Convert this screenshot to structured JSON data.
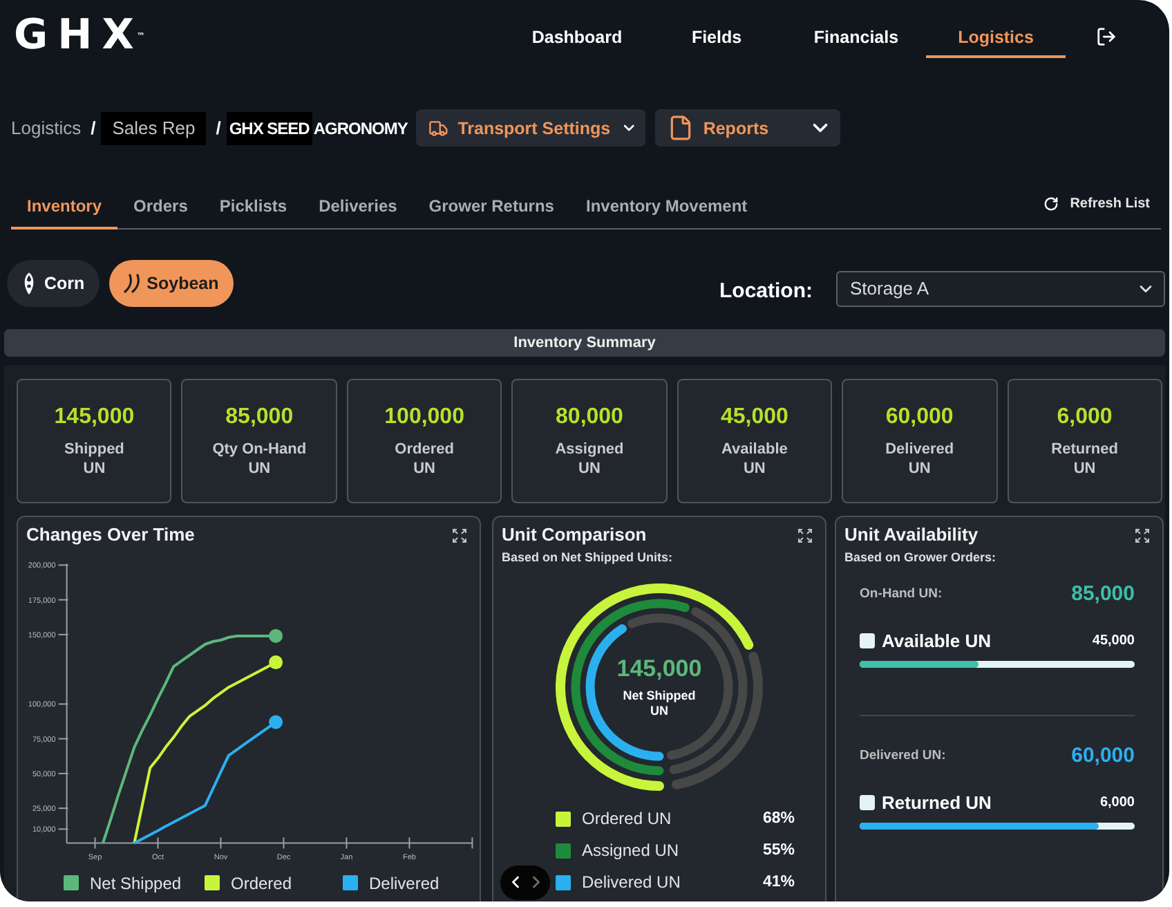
{
  "logo": {
    "text": "GHX$^{™}$"
  },
  "nav": {
    "items": [
      {
        "label": "Dashboard",
        "selected": false
      },
      {
        "label": "Fields",
        "selected": false
      },
      {
        "label": "Financials",
        "selected": false
      },
      {
        "label": "Logistics",
        "selected": true
      }
    ]
  },
  "breadcrumb": [
    {
      "kind": "link",
      "text": "Logistics"
    },
    {
      "kind": "separator",
      "text": "/"
    },
    {
      "kind": "chip",
      "text": "Sales Rep"
    },
    {
      "kind": "separator",
      "text": "/"
    },
    {
      "kind": "brand_chip",
      "text": "GHX SEED"
    },
    {
      "kind": "brand",
      "text": "AGRONOMY"
    }
  ],
  "menus": [
    {
      "kind": "truck",
      "label": "Transport Settings"
    },
    {
      "kind": "document",
      "label": "Reports"
    }
  ],
  "tabs": [
    {
      "label": "Inventory",
      "selected": true
    },
    {
      "label": "Orders",
      "selected": false
    },
    {
      "label": "Picklists",
      "selected": false
    },
    {
      "label": "Deliveries",
      "selected": false
    },
    {
      "label": "Grower Returns",
      "selected": false
    },
    {
      "label": "Inventory Movement",
      "selected": false
    }
  ],
  "refresh": {
    "label": "Refresh List"
  },
  "crops": [
    {
      "kind": "corn",
      "label": "Corn",
      "selected": false
    },
    {
      "kind": "soybean",
      "label": "Soybean",
      "selected": true
    }
  ],
  "location": {
    "label": "Location:",
    "value": "Storage A"
  },
  "summary": {
    "title": "Inventory Summary",
    "stats": [
      {
        "value": "145,000",
        "label": "Shipped",
        "unit": "UN"
      },
      {
        "value": "85,000",
        "label": "Qty On-Hand",
        "unit": "UN"
      },
      {
        "value": "100,000",
        "label": "Ordered",
        "unit": "UN"
      },
      {
        "value": "80,000",
        "label": "Assigned",
        "unit": "UN"
      },
      {
        "value": "45,000",
        "label": "Available",
        "unit": "UN"
      },
      {
        "value": "60,000",
        "label": "Delivered",
        "unit": "UN"
      },
      {
        "value": "6,000",
        "label": "Returned",
        "unit": "UN"
      }
    ]
  },
  "changes_over_time": {
    "chart_data": {
      "type": "line",
      "title": "Changes Over Time",
      "legend": "bottom",
      "categories": [
        "Sep",
        null,
        null,
        null,
        null,
        null,
        null,
        null,
        "Oct",
        null,
        null,
        null,
        null,
        null,
        null,
        null,
        "Nov",
        null,
        null,
        null,
        null,
        null,
        null,
        null,
        "Dec",
        null,
        null,
        null,
        null,
        null,
        null,
        null,
        "Jan",
        null,
        null,
        null,
        null,
        null,
        null,
        null,
        "Feb"
      ],
      "ylim": [
        0,
        200000
      ],
      "yticks": [
        {
          "value": 200000,
          "label": "200,000"
        },
        {
          "value": 175000,
          "label": "175,000"
        },
        {
          "value": 150000,
          "label": "150,000"
        },
        {
          "value": 100000,
          "label": "100,000"
        },
        {
          "value": 75000,
          "label": "75,000"
        },
        {
          "value": 50000,
          "label": "50,000"
        },
        {
          "value": 25000,
          "label": "25,000"
        },
        {
          "value": 10000,
          "label": "10,000"
        }
      ],
      "series": [
        {
          "name": "Net Shipped",
          "color": "#5cb87a",
          "values": [
            null,
            0,
            17000,
            35000,
            52000,
            69000,
            81000,
            92000,
            104000,
            115000,
            127000,
            131000,
            135000,
            139000,
            143000,
            145000,
            146000,
            148000,
            149000,
            149000,
            149000,
            149000,
            149000,
            149000,
            null,
            null,
            null,
            null,
            null,
            null,
            null,
            null,
            null,
            null,
            null,
            null,
            null,
            null,
            null,
            null,
            null
          ]
        },
        {
          "name": "Ordered",
          "color": "#c8f53b",
          "values": [
            null,
            null,
            null,
            null,
            null,
            0,
            27000,
            54000,
            61000,
            69000,
            76000,
            84000,
            91000,
            95000,
            99000,
            104000,
            108000,
            112000,
            115000,
            118000,
            121000,
            124000,
            127000,
            130000,
            null,
            null,
            null,
            null,
            null,
            null,
            null,
            null,
            null,
            null,
            null,
            null,
            null,
            null,
            null,
            null,
            null
          ]
        },
        {
          "name": "Delivered",
          "color": "#2ab0ef",
          "values": [
            null,
            null,
            null,
            null,
            null,
            0,
            3000,
            6000,
            9000,
            12000,
            15000,
            18000,
            21000,
            24000,
            27000,
            39000,
            51000,
            63000,
            67000,
            71000,
            75000,
            79000,
            83000,
            87000,
            null,
            null,
            null,
            null,
            null,
            null,
            null,
            null,
            null,
            null,
            null,
            null,
            null,
            null,
            null,
            null,
            null
          ]
        }
      ]
    }
  },
  "unit_comparison": {
    "title": "Unit Comparison",
    "subtitle": "Based on Net Shipped Units:",
    "center_value": "145,000",
    "center_label": "Net Shipped",
    "center_unit": "UN",
    "rings": [
      {
        "label": "Ordered UN",
        "reading": "68%",
        "color": "#c8f53b"
      },
      {
        "label": "Assigned UN",
        "reading": "55%",
        "color": "#1e8a3c"
      },
      {
        "label": "Delivered UN",
        "reading": "41%",
        "color": "#2ab0ef"
      }
    ]
  },
  "unit_availability": {
    "title": "Unit Availability",
    "subtitle": "Based on Grower Orders:",
    "groups": [
      {
        "label": "On-Hand UN:",
        "total": "85,000",
        "color": "#3dbfa8",
        "item": "Available UN",
        "reading": "45,000",
        "level": 0.43
      },
      {
        "label": "Delivered UN:",
        "total": "60,000",
        "color": "#2ab0ef",
        "item": "Returned UN",
        "reading": "6,000",
        "level": 0.87
      }
    ]
  },
  "carousel": {
    "previous": {
      "disabled": false
    },
    "next": {
      "disabled": true
    }
  }
}
